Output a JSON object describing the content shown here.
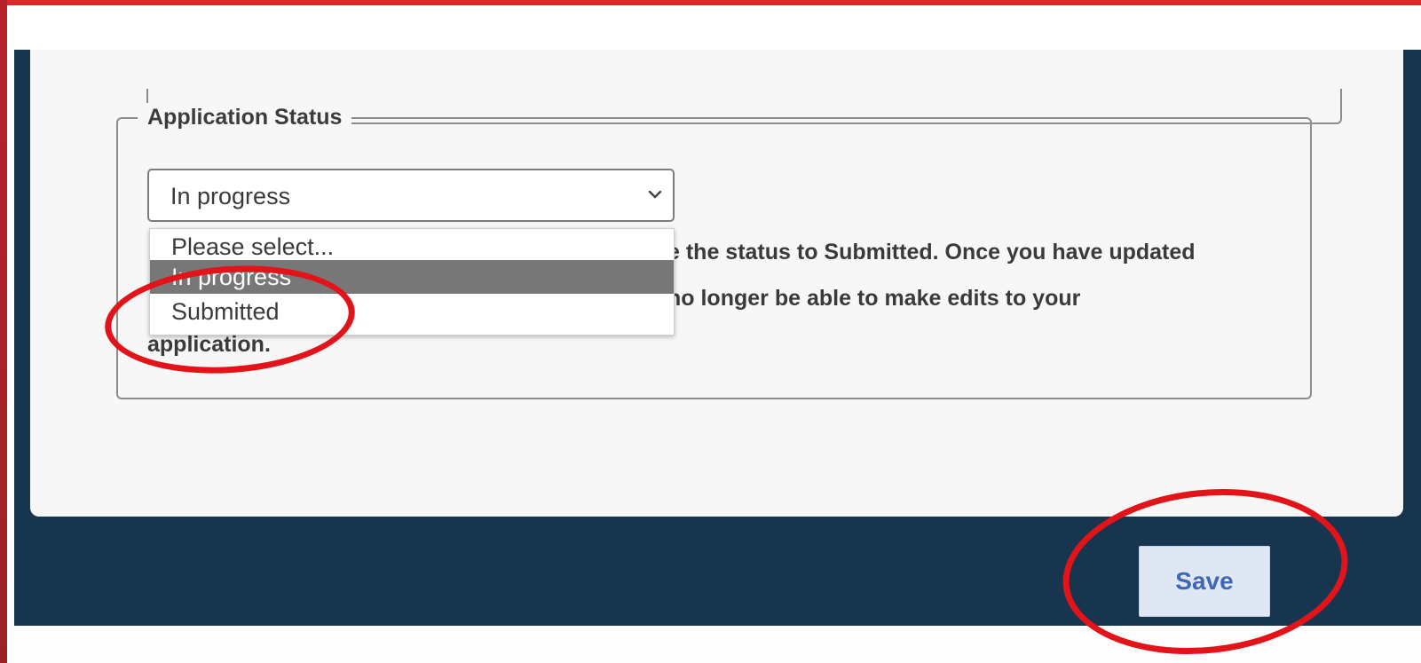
{
  "form": {
    "section_legend": "Application Status",
    "status_select": {
      "value": "In progress",
      "options": [
        "Please select...",
        "In progress",
        "Submitted"
      ],
      "highlighted_option": "In progress"
    },
    "help_text": {
      "visible_part_1": "e the status to Submitted. Once you have updated",
      "visible_part_2": "no longer be able to make edits to your",
      "visible_part_3": "application."
    }
  },
  "footer": {
    "save_label": "Save"
  },
  "colors": {
    "top_band": "#d72a2c",
    "left_band": "#b8232a",
    "footer_navy": "#17354f",
    "card_bg": "#f7f7f7",
    "selected_option_bg": "#777777",
    "save_button_bg": "#dfe6f4",
    "save_button_text": "#3f67b6",
    "annotation_red": "#e3131a"
  },
  "icons": {
    "select_chevron": "chevron-down-icon"
  }
}
